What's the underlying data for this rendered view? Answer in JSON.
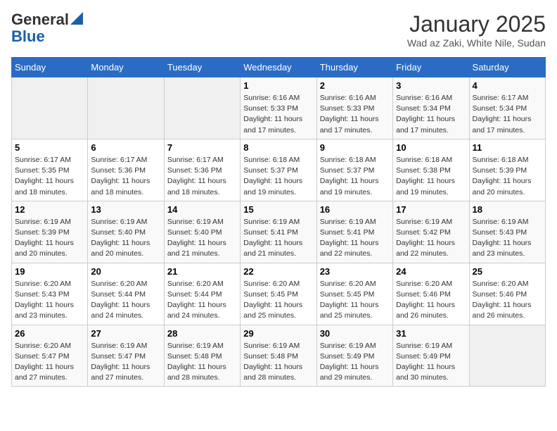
{
  "header": {
    "logo_line1": "General",
    "logo_line2": "Blue",
    "month_title": "January 2025",
    "subtitle": "Wad az Zaki, White Nile, Sudan"
  },
  "days_of_week": [
    "Sunday",
    "Monday",
    "Tuesday",
    "Wednesday",
    "Thursday",
    "Friday",
    "Saturday"
  ],
  "weeks": [
    [
      {
        "num": "",
        "info": ""
      },
      {
        "num": "",
        "info": ""
      },
      {
        "num": "",
        "info": ""
      },
      {
        "num": "1",
        "info": "Sunrise: 6:16 AM\nSunset: 5:33 PM\nDaylight: 11 hours and 17 minutes."
      },
      {
        "num": "2",
        "info": "Sunrise: 6:16 AM\nSunset: 5:33 PM\nDaylight: 11 hours and 17 minutes."
      },
      {
        "num": "3",
        "info": "Sunrise: 6:16 AM\nSunset: 5:34 PM\nDaylight: 11 hours and 17 minutes."
      },
      {
        "num": "4",
        "info": "Sunrise: 6:17 AM\nSunset: 5:34 PM\nDaylight: 11 hours and 17 minutes."
      }
    ],
    [
      {
        "num": "5",
        "info": "Sunrise: 6:17 AM\nSunset: 5:35 PM\nDaylight: 11 hours and 18 minutes."
      },
      {
        "num": "6",
        "info": "Sunrise: 6:17 AM\nSunset: 5:36 PM\nDaylight: 11 hours and 18 minutes."
      },
      {
        "num": "7",
        "info": "Sunrise: 6:17 AM\nSunset: 5:36 PM\nDaylight: 11 hours and 18 minutes."
      },
      {
        "num": "8",
        "info": "Sunrise: 6:18 AM\nSunset: 5:37 PM\nDaylight: 11 hours and 19 minutes."
      },
      {
        "num": "9",
        "info": "Sunrise: 6:18 AM\nSunset: 5:37 PM\nDaylight: 11 hours and 19 minutes."
      },
      {
        "num": "10",
        "info": "Sunrise: 6:18 AM\nSunset: 5:38 PM\nDaylight: 11 hours and 19 minutes."
      },
      {
        "num": "11",
        "info": "Sunrise: 6:18 AM\nSunset: 5:39 PM\nDaylight: 11 hours and 20 minutes."
      }
    ],
    [
      {
        "num": "12",
        "info": "Sunrise: 6:19 AM\nSunset: 5:39 PM\nDaylight: 11 hours and 20 minutes."
      },
      {
        "num": "13",
        "info": "Sunrise: 6:19 AM\nSunset: 5:40 PM\nDaylight: 11 hours and 20 minutes."
      },
      {
        "num": "14",
        "info": "Sunrise: 6:19 AM\nSunset: 5:40 PM\nDaylight: 11 hours and 21 minutes."
      },
      {
        "num": "15",
        "info": "Sunrise: 6:19 AM\nSunset: 5:41 PM\nDaylight: 11 hours and 21 minutes."
      },
      {
        "num": "16",
        "info": "Sunrise: 6:19 AM\nSunset: 5:41 PM\nDaylight: 11 hours and 22 minutes."
      },
      {
        "num": "17",
        "info": "Sunrise: 6:19 AM\nSunset: 5:42 PM\nDaylight: 11 hours and 22 minutes."
      },
      {
        "num": "18",
        "info": "Sunrise: 6:19 AM\nSunset: 5:43 PM\nDaylight: 11 hours and 23 minutes."
      }
    ],
    [
      {
        "num": "19",
        "info": "Sunrise: 6:20 AM\nSunset: 5:43 PM\nDaylight: 11 hours and 23 minutes."
      },
      {
        "num": "20",
        "info": "Sunrise: 6:20 AM\nSunset: 5:44 PM\nDaylight: 11 hours and 24 minutes."
      },
      {
        "num": "21",
        "info": "Sunrise: 6:20 AM\nSunset: 5:44 PM\nDaylight: 11 hours and 24 minutes."
      },
      {
        "num": "22",
        "info": "Sunrise: 6:20 AM\nSunset: 5:45 PM\nDaylight: 11 hours and 25 minutes."
      },
      {
        "num": "23",
        "info": "Sunrise: 6:20 AM\nSunset: 5:45 PM\nDaylight: 11 hours and 25 minutes."
      },
      {
        "num": "24",
        "info": "Sunrise: 6:20 AM\nSunset: 5:46 PM\nDaylight: 11 hours and 26 minutes."
      },
      {
        "num": "25",
        "info": "Sunrise: 6:20 AM\nSunset: 5:46 PM\nDaylight: 11 hours and 26 minutes."
      }
    ],
    [
      {
        "num": "26",
        "info": "Sunrise: 6:20 AM\nSunset: 5:47 PM\nDaylight: 11 hours and 27 minutes."
      },
      {
        "num": "27",
        "info": "Sunrise: 6:19 AM\nSunset: 5:47 PM\nDaylight: 11 hours and 27 minutes."
      },
      {
        "num": "28",
        "info": "Sunrise: 6:19 AM\nSunset: 5:48 PM\nDaylight: 11 hours and 28 minutes."
      },
      {
        "num": "29",
        "info": "Sunrise: 6:19 AM\nSunset: 5:48 PM\nDaylight: 11 hours and 28 minutes."
      },
      {
        "num": "30",
        "info": "Sunrise: 6:19 AM\nSunset: 5:49 PM\nDaylight: 11 hours and 29 minutes."
      },
      {
        "num": "31",
        "info": "Sunrise: 6:19 AM\nSunset: 5:49 PM\nDaylight: 11 hours and 30 minutes."
      },
      {
        "num": "",
        "info": ""
      }
    ]
  ]
}
